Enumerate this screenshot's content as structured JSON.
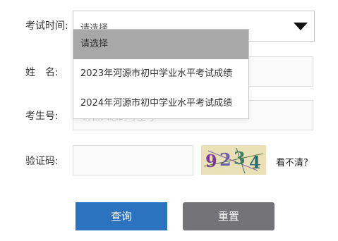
{
  "form": {
    "exam_label": "考试时间:",
    "name_label": "姓　名:",
    "student_id_label": "考生号:",
    "captcha_label": "验证码:",
    "exam_select": {
      "value": "请选择"
    },
    "student_id_placeholder": "请输入您的考生号",
    "captcha_code": [
      "9",
      "2",
      "3",
      "4"
    ],
    "refresh_text": "看不清?"
  },
  "dropdown": {
    "options": [
      {
        "label": "请选择",
        "selected": true
      },
      {
        "label": "2023年河源市初中学业水平考试成绩",
        "selected": false
      },
      {
        "label": "2024年河源市初中学业水平考试成绩",
        "selected": false
      }
    ]
  },
  "buttons": {
    "query_label": "查询",
    "reset_label": "重置"
  },
  "colors": {
    "query_button": "#2c73bf",
    "reset_button": "#737378",
    "selected_option": "#a8a8a8",
    "captcha_bg": "#e9e0b8"
  }
}
